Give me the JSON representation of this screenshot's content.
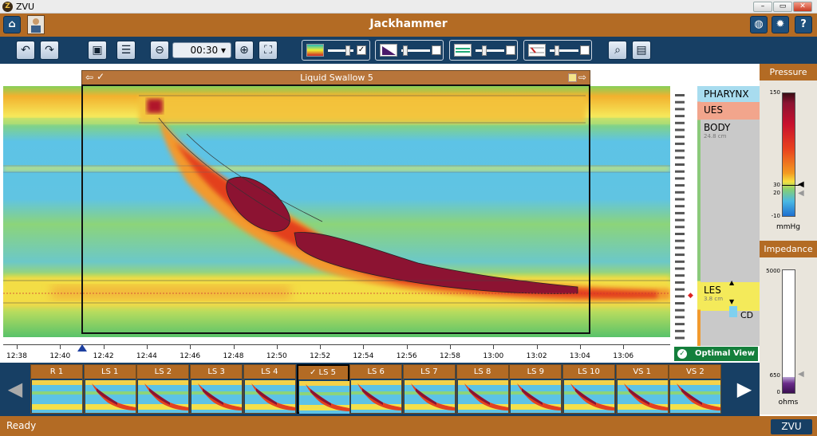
{
  "window": {
    "app_title": "ZVU",
    "app_icon_letter": "Z",
    "min": "–",
    "max": "▭",
    "close": "✕"
  },
  "header": {
    "title": "Jackhammer"
  },
  "toolbar": {
    "time_window": "00:30",
    "time_arrow": "▾"
  },
  "lookback": {
    "label": "Liquid Swallow 5"
  },
  "anatomy": {
    "zones": [
      {
        "label": "PHARYNX",
        "sub": ""
      },
      {
        "label": "UES",
        "sub": ""
      },
      {
        "label": "BODY",
        "sub": "24.8 cm"
      },
      {
        "label": "LES",
        "sub": "3.8 cm"
      }
    ],
    "cd_label": "CD"
  },
  "time_axis": {
    "ticks": [
      "12:38",
      "12:40",
      "12:42",
      "12:44",
      "12:46",
      "12:48",
      "12:50",
      "12:52",
      "12:54",
      "12:56",
      "12:58",
      "13:00",
      "13:02",
      "13:04",
      "13:06"
    ]
  },
  "optimal_view": {
    "label": "Optimal View"
  },
  "pressure": {
    "title": "Pressure",
    "ticks": [
      "150",
      "30",
      "20",
      "-10"
    ],
    "unit": "mmHg",
    "threshold_high": 30,
    "threshold_low": 20
  },
  "impedance": {
    "title": "Impedance",
    "ticks": [
      "5000",
      "650",
      "0"
    ],
    "unit": "ohms",
    "level": 650
  },
  "swallows": [
    {
      "label": "R 1",
      "selected": false
    },
    {
      "label": "LS 1",
      "selected": false
    },
    {
      "label": "LS 2",
      "selected": false
    },
    {
      "label": "LS 3",
      "selected": false
    },
    {
      "label": "LS 4",
      "selected": false
    },
    {
      "label": "LS 5",
      "selected": true
    },
    {
      "label": "LS 6",
      "selected": false
    },
    {
      "label": "LS 7",
      "selected": false
    },
    {
      "label": "LS 8",
      "selected": false
    },
    {
      "label": "LS 9",
      "selected": false
    },
    {
      "label": "LS 10",
      "selected": false
    },
    {
      "label": "VS 1",
      "selected": false
    },
    {
      "label": "VS 2",
      "selected": false
    }
  ],
  "status": {
    "text": "Ready",
    "logo": "ZVU"
  },
  "colors": {
    "header": "#b36b24",
    "toolbar": "#173f64",
    "optimal": "#147f3c"
  }
}
